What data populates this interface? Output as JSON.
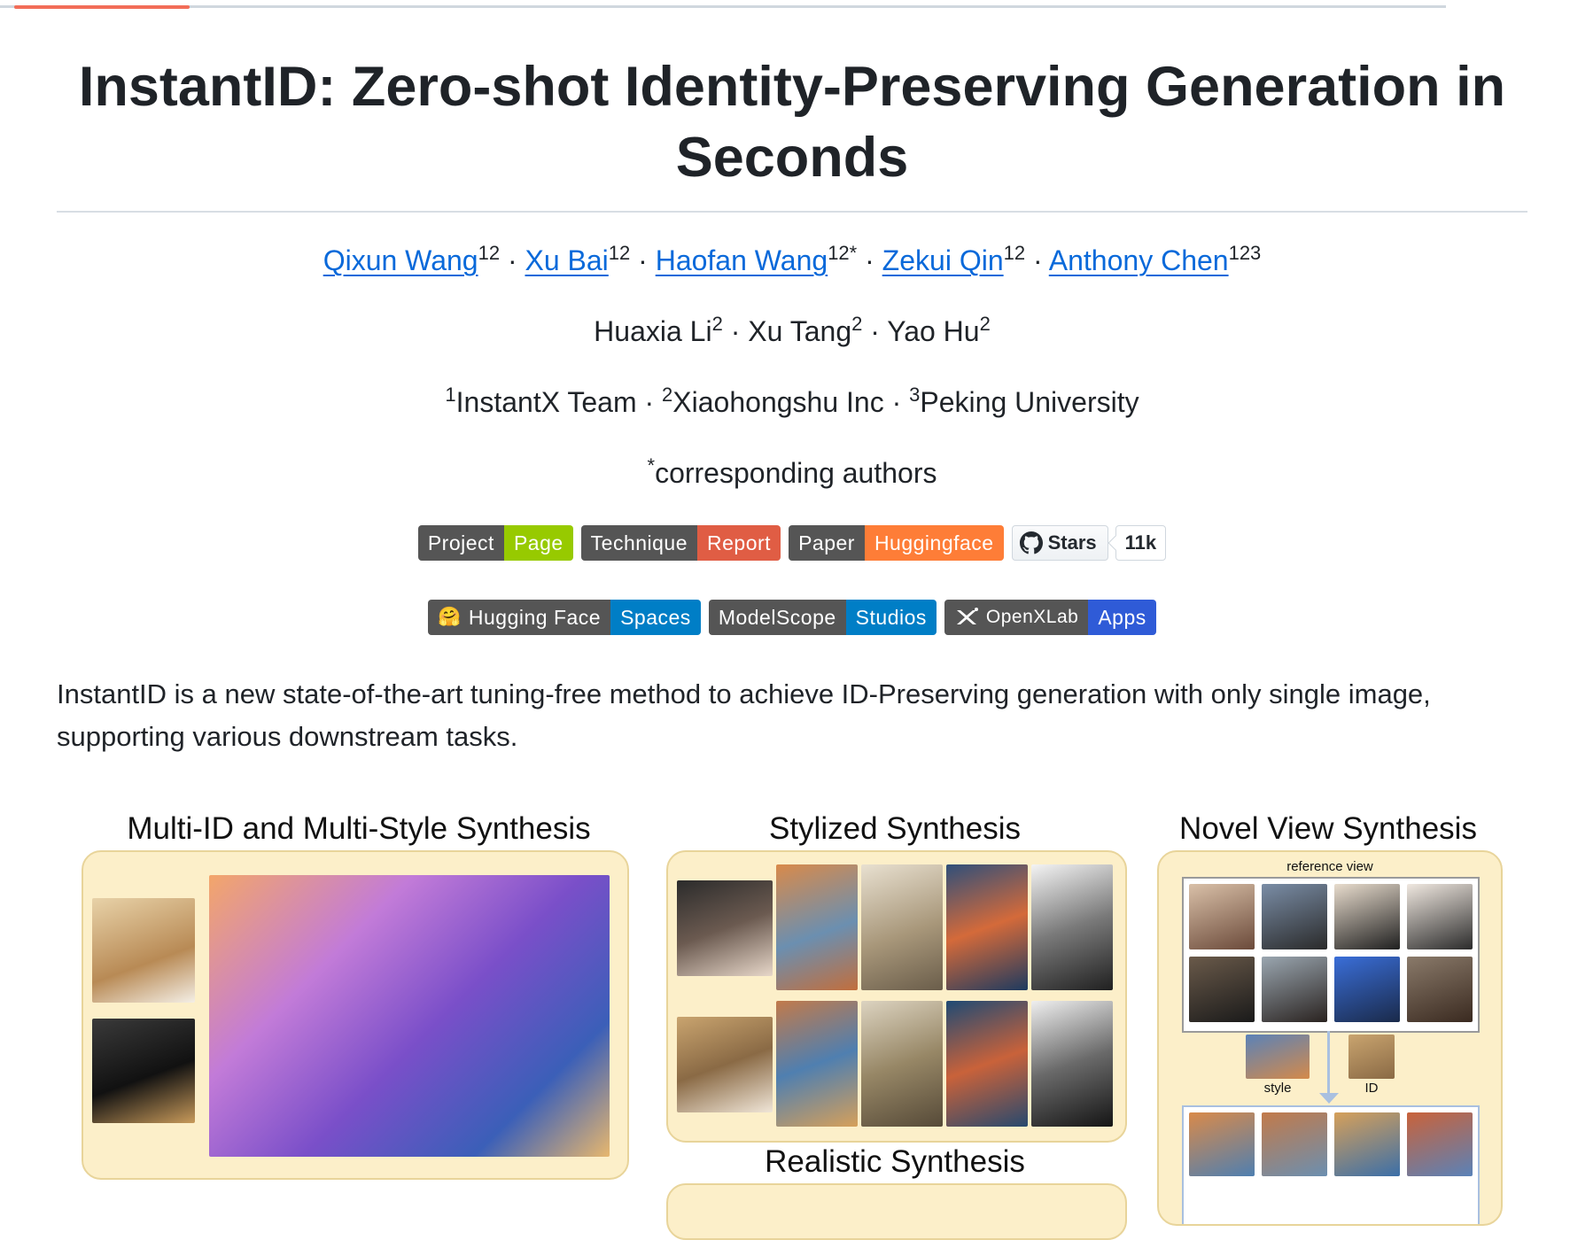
{
  "title": "InstantID: Zero-shot Identity-Preserving Generation in Seconds",
  "authors_linked": [
    {
      "name": "Qixun Wang",
      "sup": "12"
    },
    {
      "name": "Xu Bai",
      "sup": "12"
    },
    {
      "name": "Haofan Wang",
      "sup": "12*"
    },
    {
      "name": "Zekui Qin",
      "sup": "12"
    },
    {
      "name": "Anthony Chen",
      "sup": "123"
    }
  ],
  "authors_plain": [
    {
      "name": "Huaxia Li",
      "sup": "2"
    },
    {
      "name": "Xu Tang",
      "sup": "2"
    },
    {
      "name": "Yao Hu",
      "sup": "2"
    }
  ],
  "affiliations": [
    {
      "sup": "1",
      "name": "InstantX Team"
    },
    {
      "sup": "2",
      "name": "Xiaohongshu Inc"
    },
    {
      "sup": "3",
      "name": "Peking University"
    }
  ],
  "corresponding": {
    "sup": "*",
    "text": "corresponding authors"
  },
  "separator": "·",
  "badges_row1": [
    {
      "left": "Project",
      "right": "Page",
      "color": "#97ca00"
    },
    {
      "left": "Technique",
      "right": "Report",
      "color": "#e05d44"
    },
    {
      "left": "Paper",
      "right": "Huggingface",
      "color": "#fe7d37"
    }
  ],
  "github": {
    "label": "Stars",
    "count": "11k",
    "icon": "github-icon"
  },
  "badges_row2": [
    {
      "icon": "hugging-face-emoji",
      "emoji": "🤗",
      "left": "Hugging Face",
      "right": "Spaces",
      "color": "#007ec6"
    },
    {
      "left": "ModelScope",
      "right": "Studios",
      "color": "#007ec6"
    },
    {
      "icon": "openxlab-icon",
      "left": "OpenXLab",
      "right": "Apps",
      "color": "#2f5bd7"
    }
  ],
  "description": "InstantID is a new state-of-the-art tuning-free method to achieve ID-Preserving generation with only single image, supporting various downstream tasks.",
  "showcase": {
    "multi_id_title": "Multi-ID and Multi-Style Synthesis",
    "stylized_title": "Stylized Synthesis",
    "realistic_title": "Realistic Synthesis",
    "novel_view_title": "Novel View Synthesis",
    "reference_view_label": "reference view",
    "style_label": "style",
    "id_label": "ID"
  },
  "colors": {
    "link": "#0969da",
    "badge_dark": "#555555",
    "panel_bg": "#fcefc9"
  }
}
